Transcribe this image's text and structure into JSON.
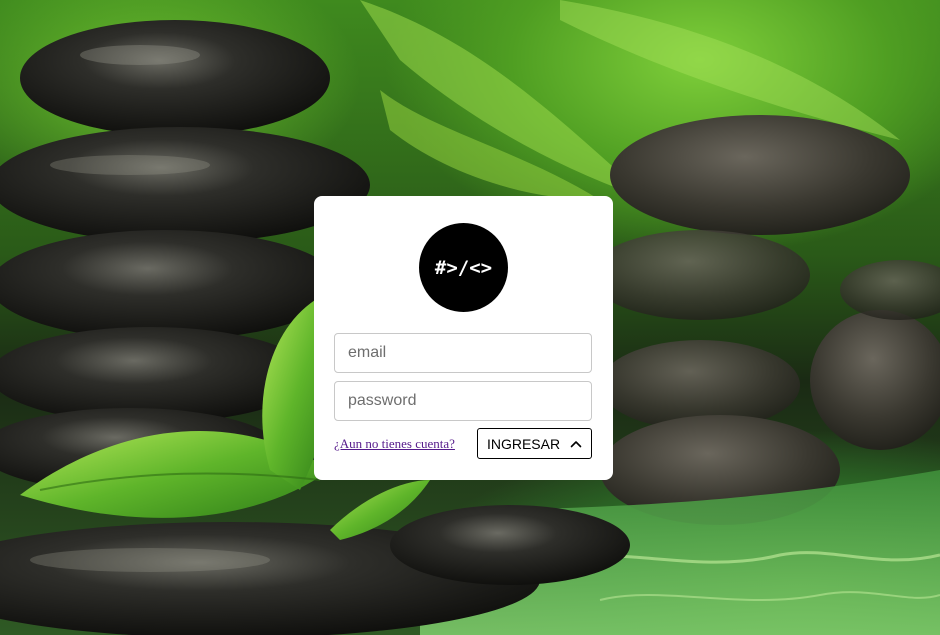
{
  "logo": {
    "text": "#>/<>"
  },
  "form": {
    "email_placeholder": "email",
    "password_placeholder": "password",
    "signup_link": "¿Aun no tienes cuenta?",
    "submit_label": "INGRESAR",
    "submit_icon": "chevron-up-icon"
  },
  "colors": {
    "card_bg": "#ffffff",
    "logo_bg": "#000000",
    "link": "#551a8b"
  }
}
